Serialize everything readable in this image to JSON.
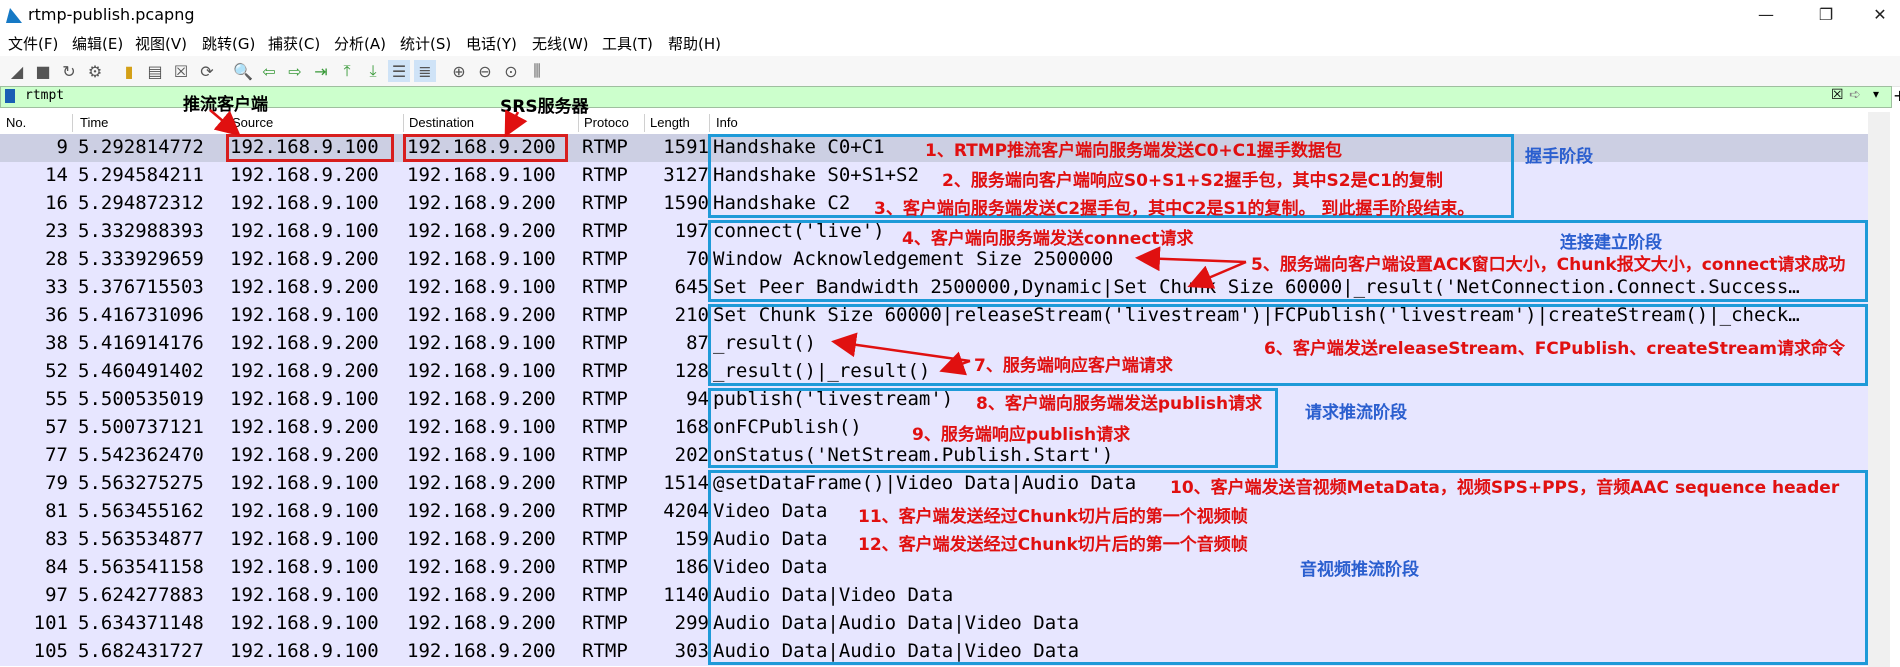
{
  "window": {
    "title": "rtmp-publish.pcapng",
    "minimize": "—",
    "maximize": "❐",
    "close": "✕"
  },
  "menu": [
    "文件(F)",
    "编辑(E)",
    "视图(V)",
    "跳转(G)",
    "捕获(C)",
    "分析(A)",
    "统计(S)",
    "电话(Y)",
    "无线(W)",
    "工具(T)",
    "帮助(H)"
  ],
  "filter": {
    "value": "rtmpt"
  },
  "columns": {
    "no": "No.",
    "time": "Time",
    "source": "Source",
    "destination": "Destination",
    "protocol": "Protoco",
    "length": "Length",
    "info": "Info"
  },
  "packets": [
    {
      "no": "9",
      "time": "5.292814772",
      "src": "192.168.9.100",
      "dst": "192.168.9.200",
      "proto": "RTMP",
      "len": "1591",
      "info": "Handshake C0+C1"
    },
    {
      "no": "14",
      "time": "5.294584211",
      "src": "192.168.9.200",
      "dst": "192.168.9.100",
      "proto": "RTMP",
      "len": "3127",
      "info": "Handshake S0+S1+S2"
    },
    {
      "no": "16",
      "time": "5.294872312",
      "src": "192.168.9.100",
      "dst": "192.168.9.200",
      "proto": "RTMP",
      "len": "1590",
      "info": "Handshake C2"
    },
    {
      "no": "23",
      "time": "5.332988393",
      "src": "192.168.9.100",
      "dst": "192.168.9.200",
      "proto": "RTMP",
      "len": "197",
      "info": "connect('live')"
    },
    {
      "no": "28",
      "time": "5.333929659",
      "src": "192.168.9.200",
      "dst": "192.168.9.100",
      "proto": "RTMP",
      "len": "70",
      "info": "Window Acknowledgement Size 2500000"
    },
    {
      "no": "33",
      "time": "5.376715503",
      "src": "192.168.9.200",
      "dst": "192.168.9.100",
      "proto": "RTMP",
      "len": "645",
      "info": "Set Peer Bandwidth 2500000,Dynamic|Set Chunk Size 60000|_result('NetConnection.Connect.Success…"
    },
    {
      "no": "36",
      "time": "5.416731096",
      "src": "192.168.9.100",
      "dst": "192.168.9.200",
      "proto": "RTMP",
      "len": "210",
      "info": "Set Chunk Size 60000|releaseStream('livestream')|FCPublish('livestream')|createStream()|_check…"
    },
    {
      "no": "38",
      "time": "5.416914176",
      "src": "192.168.9.200",
      "dst": "192.168.9.100",
      "proto": "RTMP",
      "len": "87",
      "info": "_result()"
    },
    {
      "no": "52",
      "time": "5.460491402",
      "src": "192.168.9.200",
      "dst": "192.168.9.100",
      "proto": "RTMP",
      "len": "128",
      "info": "_result()|_result()"
    },
    {
      "no": "55",
      "time": "5.500535019",
      "src": "192.168.9.100",
      "dst": "192.168.9.200",
      "proto": "RTMP",
      "len": "94",
      "info": "publish('livestream')"
    },
    {
      "no": "57",
      "time": "5.500737121",
      "src": "192.168.9.200",
      "dst": "192.168.9.100",
      "proto": "RTMP",
      "len": "168",
      "info": "onFCPublish()"
    },
    {
      "no": "77",
      "time": "5.542362470",
      "src": "192.168.9.200",
      "dst": "192.168.9.100",
      "proto": "RTMP",
      "len": "202",
      "info": "onStatus('NetStream.Publish.Start')"
    },
    {
      "no": "79",
      "time": "5.563275275",
      "src": "192.168.9.100",
      "dst": "192.168.9.200",
      "proto": "RTMP",
      "len": "1514",
      "info": "@setDataFrame()|Video Data|Audio Data"
    },
    {
      "no": "81",
      "time": "5.563455162",
      "src": "192.168.9.100",
      "dst": "192.168.9.200",
      "proto": "RTMP",
      "len": "4204",
      "info": "Video Data"
    },
    {
      "no": "83",
      "time": "5.563534877",
      "src": "192.168.9.100",
      "dst": "192.168.9.200",
      "proto": "RTMP",
      "len": "159",
      "info": "Audio Data"
    },
    {
      "no": "84",
      "time": "5.563541158",
      "src": "192.168.9.100",
      "dst": "192.168.9.200",
      "proto": "RTMP",
      "len": "186",
      "info": "Video Data"
    },
    {
      "no": "97",
      "time": "5.624277883",
      "src": "192.168.9.100",
      "dst": "192.168.9.200",
      "proto": "RTMP",
      "len": "1140",
      "info": "Audio Data|Video Data"
    },
    {
      "no": "101",
      "time": "5.634371148",
      "src": "192.168.9.100",
      "dst": "192.168.9.200",
      "proto": "RTMP",
      "len": "299",
      "info": "Audio Data|Audio Data|Video Data"
    },
    {
      "no": "105",
      "time": "5.682431727",
      "src": "192.168.9.100",
      "dst": "192.168.9.200",
      "proto": "RTMP",
      "len": "303",
      "info": "Audio Data|Audio Data|Video Data"
    }
  ],
  "labels": {
    "client": "推流客户端",
    "server": "SRS服务器"
  },
  "annotations": {
    "a1": "1、RTMP推流客户端向服务端发送C0+C1握手数据包",
    "a2": "2、服务端向客户端响应S0+S1+S2握手包，其中S2是C1的复制",
    "a3": "3、客户端向服务端发送C2握手包，其中C2是S1的复制。  到此握手阶段结束。",
    "a4": "4、客户端向服务端发送connect请求",
    "a5": "5、服务端向客户端设置ACK窗口大小，Chunk报文大小，connect请求成功",
    "a6": "6、客户端发送releaseStream、FCPublish、createStream请求命令",
    "a7": "7、服务端响应客户端请求",
    "a8": "8、客户端向服务端发送publish请求",
    "a9": "9、服务端响应publish请求",
    "a10": "10、客户端发送音视频MetaData，视频SPS+PPS，音频AAC sequence header",
    "a11": "11、客户端发送经过Chunk切片后的第一个视频帧",
    "a12": "12、客户端发送经过Chunk切片后的第一个音频帧"
  },
  "stages": {
    "handshake": "握手阶段",
    "connect": "连接建立阶段",
    "publish": "请求推流阶段",
    "media": "音视频推流阶段"
  }
}
